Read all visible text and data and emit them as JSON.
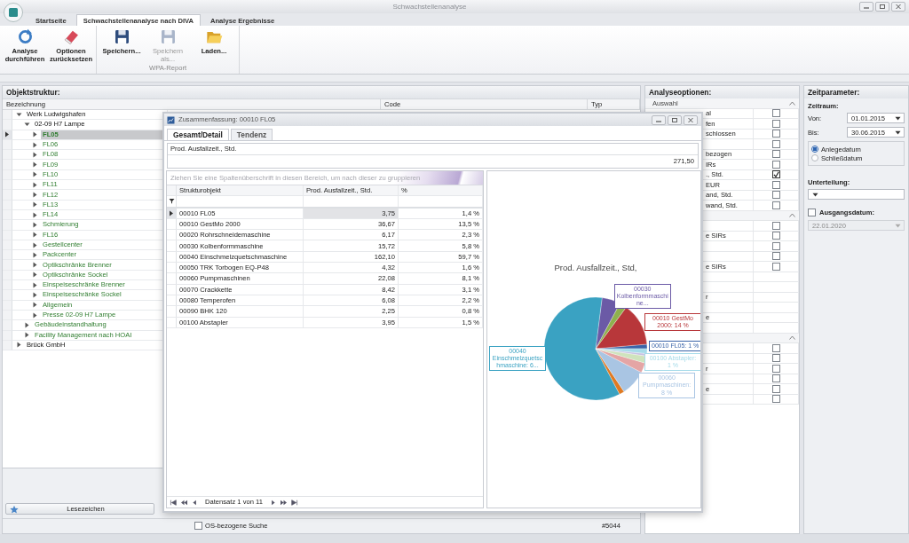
{
  "window": {
    "title": "Schwachstellenanalyse"
  },
  "ribbon": {
    "tabs": [
      {
        "label": "Startseite",
        "selected": false
      },
      {
        "label": "Schwachstellenanalyse nach DIVA",
        "selected": true
      },
      {
        "label": "Analyse Ergebnisse",
        "selected": false
      }
    ],
    "groups": [
      {
        "buttons": [
          {
            "label": "Analyse durchführen",
            "kind": "refresh",
            "disabled": false
          },
          {
            "label": "Optionen zurücksetzen",
            "kind": "eraser",
            "disabled": false
          }
        ]
      },
      {
        "label": "WPA-Report",
        "buttons": [
          {
            "label": "Speichern...",
            "kind": "save",
            "disabled": false
          },
          {
            "label": "Speichern als...",
            "kind": "save",
            "disabled": true
          },
          {
            "label": "Laden...",
            "kind": "folder",
            "disabled": false
          }
        ]
      }
    ]
  },
  "objektstruktur": {
    "title": "Objektstruktur:",
    "columns": [
      "Bezeichnung",
      "Code",
      "Typ"
    ],
    "tree": [
      {
        "label": "Werk Ludwigshafen",
        "kind": "site",
        "expanded": true,
        "selected": false,
        "children": [
          {
            "label": "02-09 H7 Lampe",
            "kind": "site",
            "expanded": true,
            "selected": false,
            "children": [
              {
                "label": "FL05",
                "kind": "unit",
                "expanded": false,
                "selected": true
              },
              {
                "label": "FL06",
                "kind": "unit",
                "expanded": false,
                "selected": false
              },
              {
                "label": "FL08",
                "kind": "unit",
                "expanded": false,
                "selected": false
              },
              {
                "label": "FL09",
                "kind": "unit",
                "expanded": false,
                "selected": false
              },
              {
                "label": "FL10",
                "kind": "unit",
                "expanded": false,
                "selected": false
              },
              {
                "label": "FL11",
                "kind": "unit",
                "expanded": false,
                "selected": false
              },
              {
                "label": "FL12",
                "kind": "unit",
                "expanded": false,
                "selected": false
              },
              {
                "label": "FL13",
                "kind": "unit",
                "expanded": false,
                "selected": false
              },
              {
                "label": "FL14",
                "kind": "unit",
                "expanded": false,
                "selected": false
              },
              {
                "label": "Schmierung",
                "kind": "unit",
                "expanded": false,
                "selected": false
              },
              {
                "label": "FL16",
                "kind": "unit",
                "expanded": false,
                "selected": false
              },
              {
                "label": "Gestellcenter",
                "kind": "unit",
                "expanded": false,
                "selected": false
              },
              {
                "label": "Packcenter",
                "kind": "unit",
                "expanded": false,
                "selected": false
              },
              {
                "label": "Optikschränke Brenner",
                "kind": "unit",
                "expanded": false,
                "selected": false
              },
              {
                "label": "Optikschränke Sockel",
                "kind": "unit",
                "expanded": false,
                "selected": false
              },
              {
                "label": "Einspeiseschränke Brenner",
                "kind": "unit",
                "expanded": false,
                "selected": false
              },
              {
                "label": "Einspeiseschränke Sockel",
                "kind": "unit",
                "expanded": false,
                "selected": false
              },
              {
                "label": "Allgemein",
                "kind": "unit",
                "expanded": false,
                "selected": false
              },
              {
                "label": "Presse 02-09 H7 Lampe",
                "kind": "unit",
                "expanded": false,
                "selected": false
              }
            ]
          },
          {
            "label": "Gebäudeinstandhaltung",
            "kind": "unit",
            "expanded": false,
            "selected": false
          },
          {
            "label": "Facility Management nach HOAI",
            "kind": "unit",
            "expanded": false,
            "selected": false
          }
        ]
      },
      {
        "label": "Brück GmbH",
        "kind": "site",
        "expanded": false,
        "selected": false
      }
    ],
    "bookmark_button": "Lesezeichen",
    "search_option": {
      "label": "OS-bezogene Suche",
      "checked": false
    },
    "record_id": "#5044"
  },
  "dialog": {
    "title": "Zusammenfassung: 00010 FL05",
    "tabs": [
      {
        "label": "Gesamt/Detail",
        "selected": true
      },
      {
        "label": "Tendenz",
        "selected": false
      }
    ],
    "summary": {
      "column": "Prod. Ausfallzeit., Std.",
      "value": "271,50"
    },
    "grid": {
      "group_hint": "Ziehen Sie eine Spaltenüberschrift in diesen Bereich, um nach dieser zu gruppieren",
      "columns": [
        "Strukturobjekt",
        "Prod. Ausfallzeit., Std.",
        "%"
      ],
      "rows": [
        {
          "cells": [
            "00010 FL05",
            "3,75",
            "1,4 %"
          ],
          "selected": true
        },
        {
          "cells": [
            "00010 GestMo 2000",
            "36,67",
            "13,5 %"
          ],
          "selected": false
        },
        {
          "cells": [
            "00020 Rohrschneidemaschine",
            "6,17",
            "2,3 %"
          ],
          "selected": false
        },
        {
          "cells": [
            "00030 Kolbenformmaschine",
            "15,72",
            "5,8 %"
          ],
          "selected": false
        },
        {
          "cells": [
            "00040 Einschmelzquetschmaschine",
            "162,10",
            "59,7 %"
          ],
          "selected": false
        },
        {
          "cells": [
            "00050 TRK Torbogen EQ-P48",
            "4,32",
            "1,6 %"
          ],
          "selected": false
        },
        {
          "cells": [
            "00060 Pumpmaschinen",
            "22,08",
            "8,1 %"
          ],
          "selected": false
        },
        {
          "cells": [
            "00070 Crackkette",
            "8,42",
            "3,1 %"
          ],
          "selected": false
        },
        {
          "cells": [
            "00080 Temperofen",
            "6,08",
            "2,2 %"
          ],
          "selected": false
        },
        {
          "cells": [
            "00090 BHK 120",
            "2,25",
            "0,8 %"
          ],
          "selected": false
        },
        {
          "cells": [
            "00100 Abstapler",
            "3,95",
            "1,5 %"
          ],
          "selected": false
        }
      ],
      "navigator": "Datensatz 1 von 11"
    },
    "chart": {
      "chart_data": {
        "type": "pie",
        "title": "Prod. Ausfallzeit., Std,",
        "values": [
          1.4,
          13.5,
          2.3,
          5.8,
          59.7,
          1.6,
          8.1,
          3.1,
          2.2,
          0.8,
          1.5
        ],
        "colors": [
          "#3a64a8",
          "#b8373a",
          "#8fb04e",
          "#6b5aa6",
          "#3aa2c2",
          "#e07a22",
          "#a9c5e3",
          "#e4a5a5",
          "#cfe3bd",
          "#c9c2e2",
          "#a6dbe9"
        ],
        "value_labels": [
          "00010 FL05: 1 %",
          "00010 GestMo 2000: 14 %",
          null,
          "00030 Kolbenformmaschine...",
          null,
          null,
          "00060 Pumpmaschinen: 8 %",
          null,
          null,
          null,
          "00100 Abstapler: 1 %"
        ],
        "annotations": [
          {
            "text": "00040 Einschmelzquetschmaschine: 6..."
          }
        ]
      }
    }
  },
  "analyseoptionen": {
    "title": "Analyseoptionen:",
    "groups": [
      {
        "label": "Auswahl",
        "expanded": true,
        "rows": [
          {
            "kind": "checkbox",
            "label": "al",
            "checked": false
          },
          {
            "kind": "checkbox",
            "label": "fen",
            "checked": false
          },
          {
            "kind": "checkbox",
            "label": "schlossen",
            "checked": false
          },
          {
            "kind": "checkbox",
            "checked": false
          },
          {
            "kind": "checkbox",
            "label": "bezogen",
            "checked": false
          },
          {
            "kind": "checkbox",
            "label": "IRs",
            "checked": false
          },
          {
            "kind": "checkbox",
            "label": "., Std.",
            "checked": true
          },
          {
            "kind": "checkbox",
            "label": "EUR",
            "checked": false
          },
          {
            "kind": "checkbox",
            "label": "and, Std.",
            "checked": false
          },
          {
            "kind": "checkbox",
            "label": "wand, Std.",
            "checked": false
          }
        ]
      },
      {
        "expanded": true,
        "rows": [
          {
            "kind": "checkbox",
            "checked": false
          },
          {
            "kind": "checkbox",
            "label": "e SIRs",
            "checked": false
          },
          {
            "kind": "checkbox",
            "checked": false
          },
          {
            "kind": "checkbox",
            "checked": false
          },
          {
            "kind": "checkbox",
            "label": "e SIRs",
            "checked": false
          },
          {
            "kind": "plain"
          },
          {
            "kind": "plain"
          },
          {
            "kind": "plain",
            "label": "r"
          },
          {
            "kind": "plain"
          },
          {
            "kind": "plain",
            "label": "e"
          },
          {
            "kind": "plain"
          }
        ]
      },
      {
        "expanded": true,
        "rows": [
          {
            "kind": "checkbox",
            "checked": false
          },
          {
            "kind": "checkbox",
            "checked": false
          },
          {
            "kind": "checkbox",
            "label": "r",
            "checked": false
          },
          {
            "kind": "checkbox",
            "checked": false
          },
          {
            "kind": "checkbox",
            "label": "e",
            "checked": false
          },
          {
            "kind": "checkbox",
            "checked": false
          }
        ]
      }
    ]
  },
  "zeitparameter": {
    "title": "Zeitparameter:",
    "period_label": "Zeitraum:",
    "from": {
      "label": "Von:",
      "value": "01.01.2015"
    },
    "to": {
      "label": "Bis:",
      "value": "30.06.2015"
    },
    "date_type": [
      {
        "label": "Anlegedatum",
        "selected": true
      },
      {
        "label": "Schließdatum",
        "selected": false
      }
    ],
    "subdivision": {
      "label": "Unterteilung:"
    },
    "base_date": {
      "label": "Ausgangsdatum:",
      "checked": false,
      "value": "22.01.2020",
      "disabled": true
    }
  }
}
